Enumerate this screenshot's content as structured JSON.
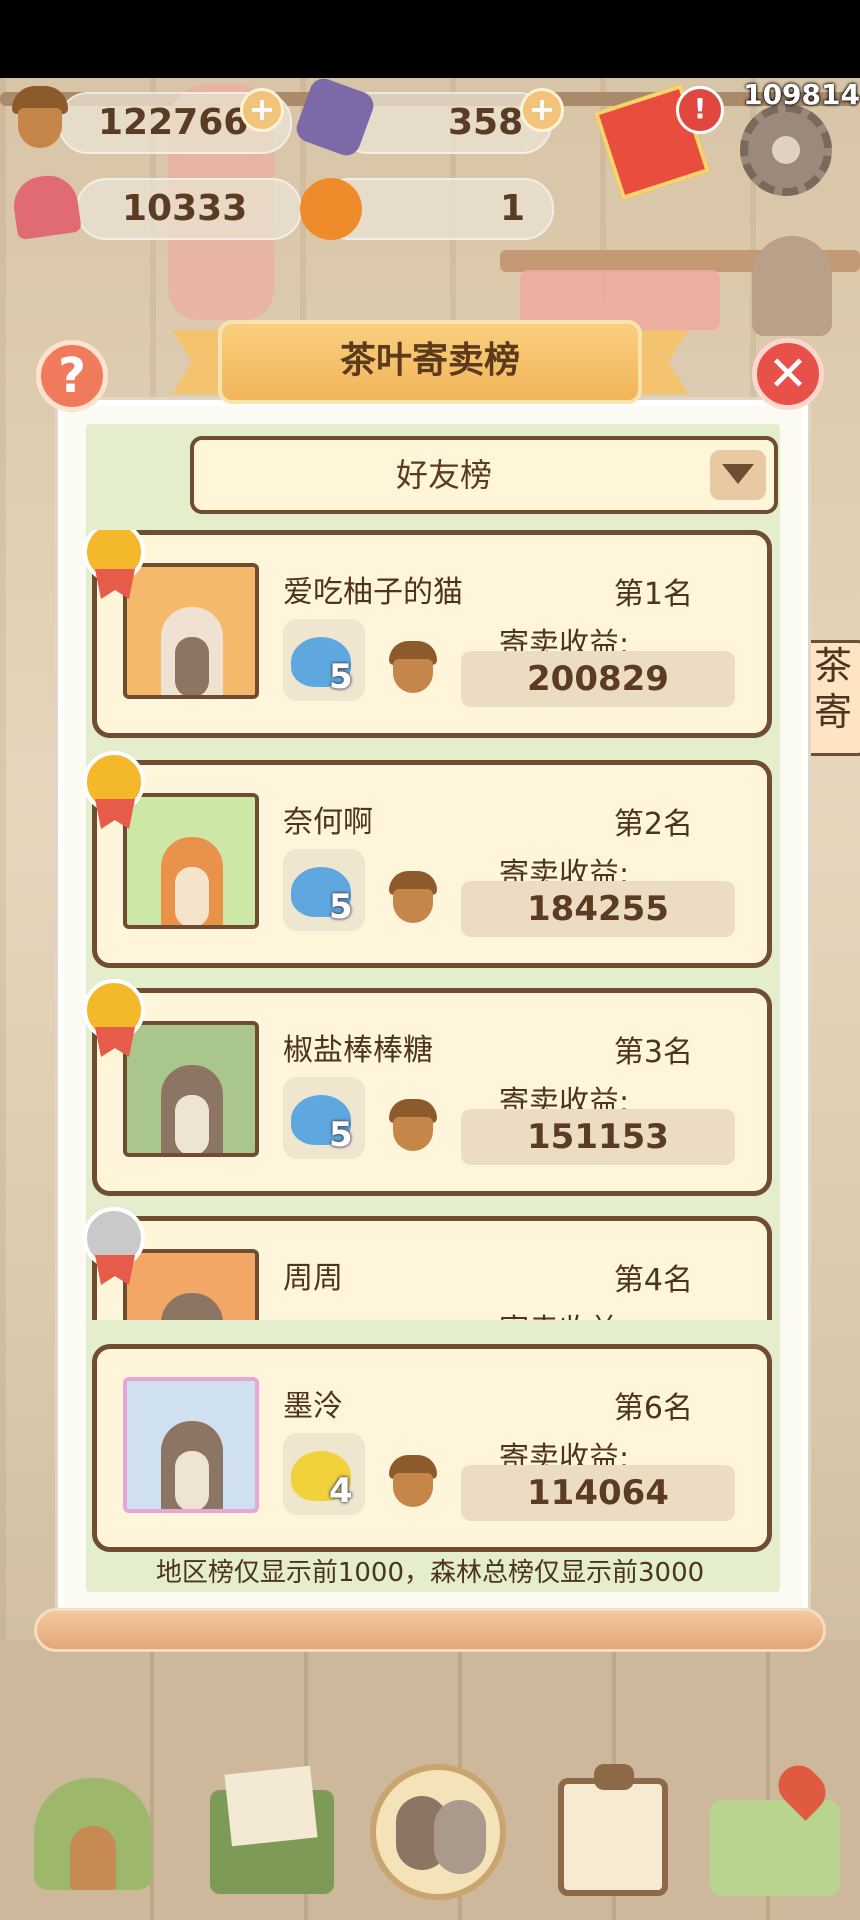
{
  "resources": {
    "acorns": "122766",
    "gems": "358",
    "hearts": "10333",
    "oranges": "1",
    "counter": "109814"
  },
  "title": "茶叶寄卖榜",
  "board_select": "好友榜",
  "earnings_label": "寄卖收益:",
  "entries": [
    {
      "name": "爱吃柚子的猫",
      "rank": "第1名",
      "teapot_level": "5",
      "earnings": "200829"
    },
    {
      "name": "奈何啊",
      "rank": "第2名",
      "teapot_level": "5",
      "earnings": "184255"
    },
    {
      "name": "椒盐棒棒糖",
      "rank": "第3名",
      "teapot_level": "5",
      "earnings": "151153"
    },
    {
      "name": "周周",
      "rank": "第4名",
      "teapot_level": "",
      "earnings": ""
    }
  ],
  "self_entry": {
    "name": "墨泠",
    "rank": "第6名",
    "teapot_level": "4",
    "earnings": "114064"
  },
  "footnote": "地区榜仅显示前1000，森林总榜仅显示前3000",
  "side_sign": "茶\n寄",
  "colors": {
    "gold_medal": "#f3b92a",
    "silver_medal": "#c9c9c9",
    "card_border": "#6f4d33",
    "blue_teapot": "#5fa8df",
    "yellow_teapot": "#f1d23a"
  },
  "icons": [
    "acorn-icon",
    "gem-icon",
    "heart-icon",
    "orange-icon",
    "gear-icon",
    "help-icon",
    "close-icon",
    "chevron-down-icon",
    "teapot-icon",
    "medal-icon"
  ]
}
